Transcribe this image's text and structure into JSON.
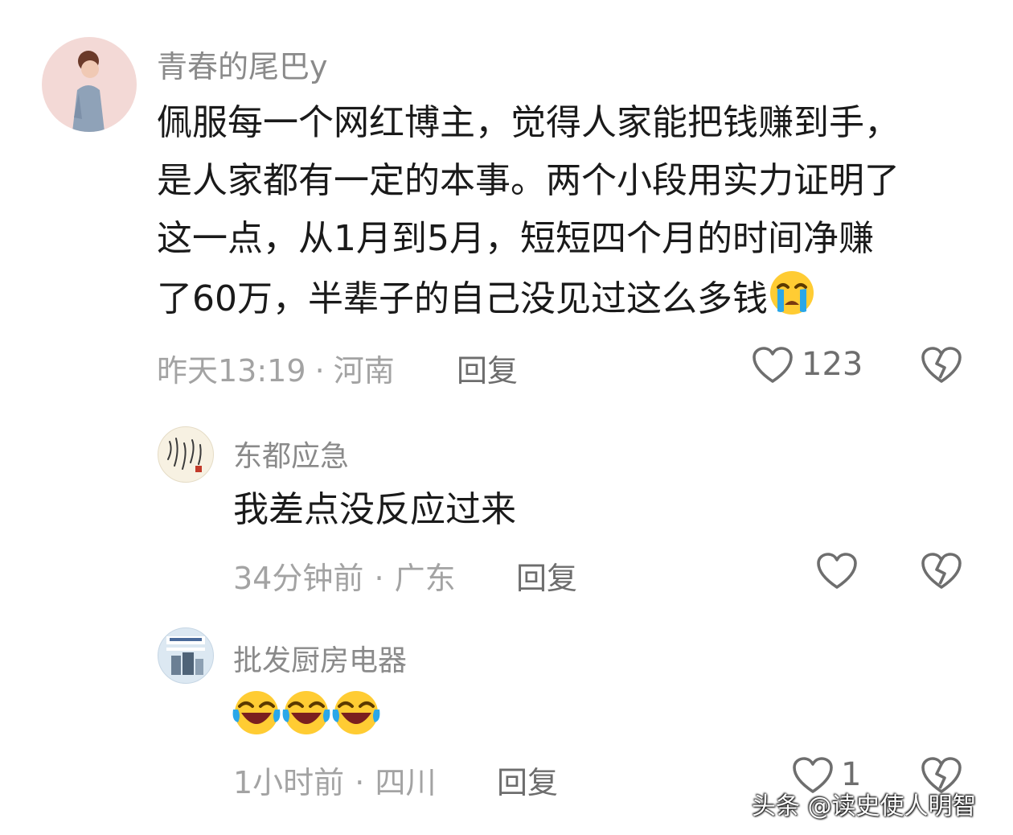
{
  "comments": [
    {
      "username": "青春的尾巴y",
      "lines": [
        "佩服每一个网红博主，觉得人家能把钱赚到手，",
        "是人家都有一定的本事。两个小段用实力证明了",
        "这一点，从1月到5月，短短四个月的时间净赚",
        "了60万，半辈子的自己没见过这么多钱"
      ],
      "time": "昨天13:19",
      "sep": "·",
      "location": "河南",
      "reply": "回复",
      "likes": "123"
    }
  ],
  "replies": [
    {
      "username": "东都应急",
      "text": "我差点没反应过来",
      "time": "34分钟前",
      "sep": "·",
      "location": "广东",
      "reply": "回复"
    },
    {
      "username": "批发厨房电器",
      "time": "1小时前",
      "sep": "·",
      "location": "四川",
      "reply": "回复",
      "likes": "1"
    }
  ],
  "watermark": "头条 @读史使人明智",
  "icons": {
    "like": "heart-outline-icon",
    "dislike": "broken-heart-icon",
    "emoji_crying": "loudly-crying-face-emoji",
    "emoji_laughing": "laughing-tears-emoji"
  },
  "colors": {
    "username": "#8a8a8a",
    "meta": "#a3a3a3",
    "text": "#1a1a1a",
    "emoji_yellow": "#ffcc33",
    "tears": "#2aa7e8"
  }
}
